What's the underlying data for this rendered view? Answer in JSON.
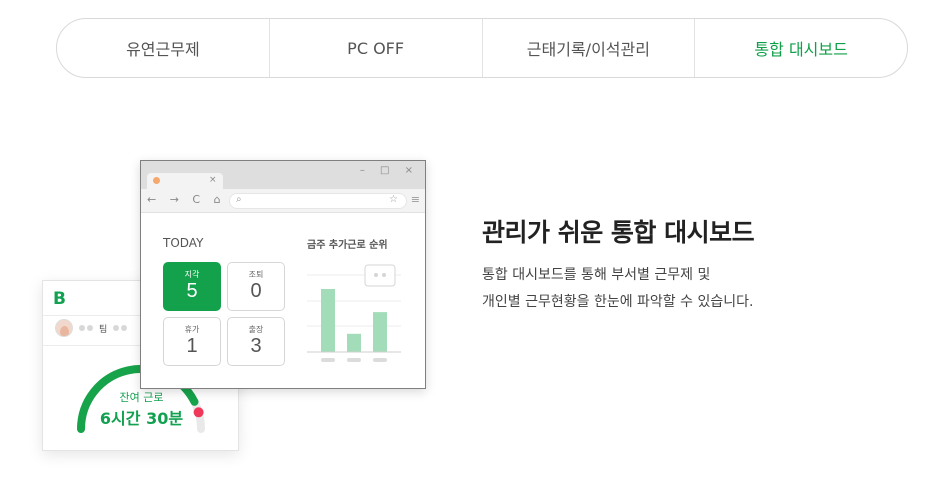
{
  "tabs": [
    {
      "label": "유연근무제",
      "active": false
    },
    {
      "label": "PC OFF",
      "active": false
    },
    {
      "label": "근태기록/이석관리",
      "active": false
    },
    {
      "label": "통합 대시보드",
      "active": true
    }
  ],
  "phone": {
    "logo": "B",
    "team_label": "팀",
    "gauge_label": "잔여 근로",
    "gauge_value": "6시간 30분",
    "gauge_fraction": 0.85
  },
  "browser": {
    "tab_close": "×",
    "window_controls": "– □ ×",
    "nav_icons": "← → C ⌂",
    "today_label": "TODAY",
    "rank_title": "금주 추가근로 순위",
    "tiles": [
      {
        "label": "지각",
        "value": "5",
        "highlight": true
      },
      {
        "label": "조퇴",
        "value": "0",
        "highlight": false
      },
      {
        "label": "휴가",
        "value": "1",
        "highlight": false
      },
      {
        "label": "출장",
        "value": "3",
        "highlight": false
      }
    ],
    "rank_bar_levels": [
      0.9,
      0.26,
      0.57
    ]
  },
  "content": {
    "headline": "관리가 쉬운 통합 대시보드",
    "desc_line1": "통합 대시보드를 통해 부서별 근무제 및",
    "desc_line2": "개인별 근무현황을 한눈에 파악할 수 있습니다."
  },
  "colors": {
    "accent": "#10a04a",
    "bar": "#a3dcb8",
    "gauge_red": "#f0395a"
  }
}
